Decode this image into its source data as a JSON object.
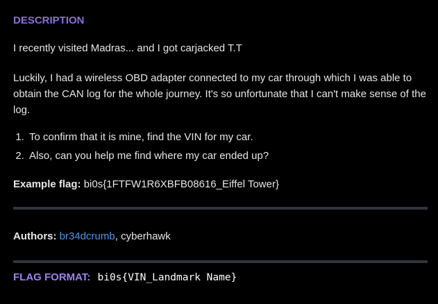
{
  "description": {
    "heading": "DESCRIPTION",
    "line1": "I recently visited Madras... and I got carjacked T.T",
    "paragraph": "Luckily, I had a wireless OBD adapter connected to my car through which I was able to obtain the CAN log for the whole journey. It's so unfortunate that I can't make sense of the log.",
    "tasks": [
      "To confirm that it is mine, find the VIN for my car.",
      "Also, can you help me find where my car ended up?"
    ],
    "example_label": "Example flag:",
    "example_value": "bi0s{1FTFW1R6XBFB08616_Eiffel Tower}"
  },
  "authors": {
    "label": "Authors:",
    "linked": "br34dcrumb",
    "separator": ", ",
    "other": "cyberhawk"
  },
  "flag_format": {
    "label": "FLAG FORMAT:",
    "value": "bi0s{VIN_Landmark Name}"
  },
  "colors": {
    "heading": "#8a6fd6",
    "link": "#4f93ea",
    "flag_label": "#a080f0",
    "divider": "#30363d"
  }
}
